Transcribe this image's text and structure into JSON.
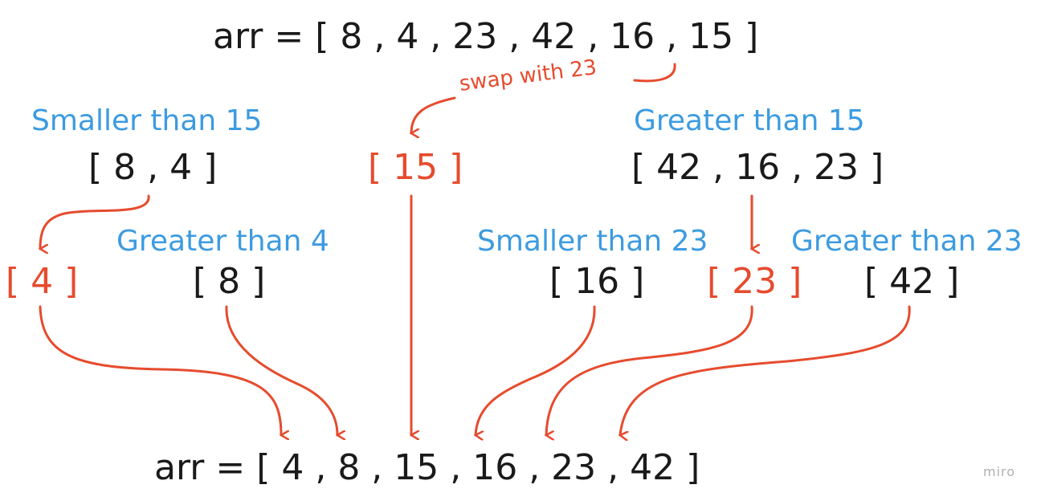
{
  "diagram": {
    "top_array": "arr = [ 8 , 4 , 23 , 42 , 16 , 15 ]",
    "swap_note": "swap with 23",
    "left_caption": "Smaller than 15",
    "left_array": "[ 8 , 4 ]",
    "pivot": "[ 15 ]",
    "right_caption": "Greater than 15",
    "right_array": "[ 42 , 16 , 23 ]",
    "left_pivot": "[ 4 ]",
    "greater_than_4_caption": "Greater than 4",
    "greater_than_4_array": "[ 8 ]",
    "smaller_than_23_caption": "Smaller than 23",
    "smaller_than_23_array": "[ 16 ]",
    "right_pivot": "[ 23 ]",
    "greater_than_23_caption": "Greater than 23",
    "greater_than_23_array": "[ 42 ]",
    "result_array": "arr = [ 4 , 8 , 15 , 16 , 23 , 42 ]",
    "watermark": "miro"
  },
  "colors": {
    "text": "#1a1a1a",
    "pivot": "#e64b2e",
    "caption": "#3c9be0",
    "arrow": "#e64b2e"
  }
}
